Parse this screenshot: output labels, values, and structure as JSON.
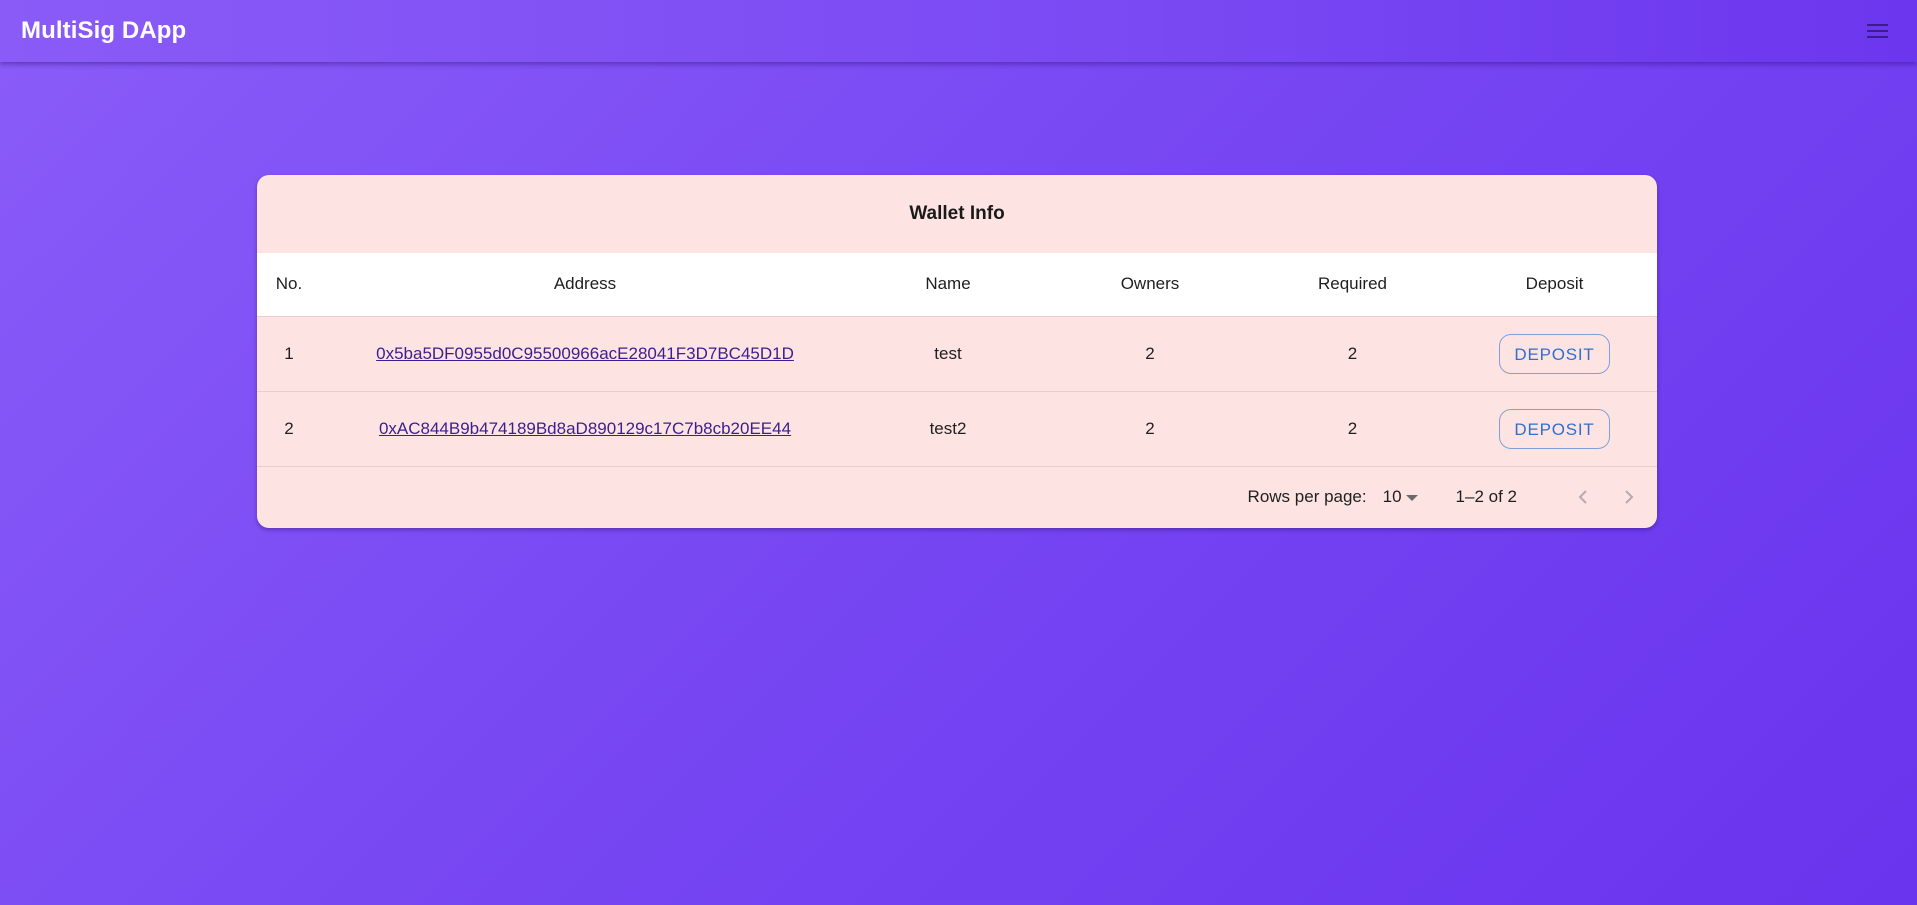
{
  "app": {
    "title": "MultiSig DApp"
  },
  "icons": {
    "menu": "hamburger-menu-icon",
    "prev": "chevron-left-icon",
    "next": "chevron-right-icon",
    "dropdown": "caret-down-icon"
  },
  "colors": {
    "background_start": "#8a5cf8",
    "background_end": "#6a33ee",
    "card_background": "#fde4e3",
    "header_row_background": "#ffffff",
    "link": "#3b1e8f",
    "deposit_button_text": "#2f6fce"
  },
  "wallet_table": {
    "title": "Wallet Info",
    "columns": [
      "No.",
      "Address",
      "Name",
      "Owners",
      "Required",
      "Deposit"
    ],
    "rows": [
      {
        "no": "1",
        "address": "0x5ba5DF0955d0C95500966acE28041F3D7BC45D1D",
        "name": "test",
        "owners": "2",
        "required": "2",
        "deposit_label": "DEPOSIT"
      },
      {
        "no": "2",
        "address": "0xAC844B9b474189Bd8aD890129c17C7b8cb20EE44",
        "name": "test2",
        "owners": "2",
        "required": "2",
        "deposit_label": "DEPOSIT"
      }
    ],
    "pagination": {
      "rows_per_page_label": "Rows per page:",
      "rows_per_page_value": "10",
      "range_text": "1–2 of 2"
    }
  }
}
